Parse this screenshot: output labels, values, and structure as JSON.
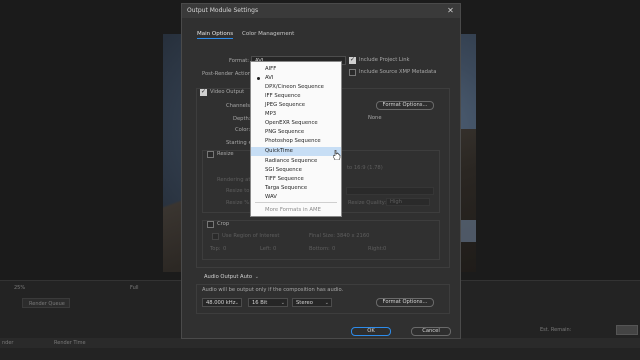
{
  "dialog": {
    "title": "Output Module Settings",
    "tabs": [
      "Main Options",
      "Color Management"
    ],
    "format_label": "Format:",
    "format_value": "AVI",
    "post_render_label": "Post-Render Action:",
    "include_project_link": "Include Project Link",
    "include_xmp": "Include Source XMP Metadata",
    "video_output": "Video Output",
    "channels_label": "Channels:",
    "depth_label": "Depth:",
    "color_label": "Color:",
    "starting_label": "Starting #:",
    "format_options": "Format Options...",
    "none_text": "None",
    "resize": "Resize",
    "rendering_at": "Rendering at:",
    "resize_to": "Resize to:",
    "resize_pct": "Resize %:",
    "resize_ratio": "to 16:9 (1.78)",
    "resize_quality_label": "Resize Quality:",
    "resize_quality_value": "High",
    "crop": "Crop",
    "use_roi": "Use Region of Interest",
    "final_size": "Final Size: 3840 x 2160",
    "top_label": "Top:",
    "left_label": "Left:",
    "bottom_label": "Bottom:",
    "right_label": "Right:",
    "zero": "0",
    "audio_output": "Audio Output Auto",
    "audio_note": "Audio will be output only if the composition has audio.",
    "sample_rate": "48.000 kHz",
    "bit_depth": "16 Bit",
    "channels_audio": "Stereo",
    "audio_format_options": "Format Options...",
    "ok": "OK",
    "cancel": "Cancel"
  },
  "dropdown": {
    "items": [
      {
        "label": "AIFF"
      },
      {
        "label": "AVI"
      },
      {
        "label": "DPX/Cineon Sequence"
      },
      {
        "label": "IFF Sequence"
      },
      {
        "label": "JPEG Sequence"
      },
      {
        "label": "MP3"
      },
      {
        "label": "OpenEXR Sequence"
      },
      {
        "label": "PNG Sequence"
      },
      {
        "label": "Photoshop Sequence"
      },
      {
        "label": "QuickTime"
      },
      {
        "label": "Radiance Sequence"
      },
      {
        "label": "SGI Sequence"
      },
      {
        "label": "TIFF Sequence"
      },
      {
        "label": "Targa Sequence"
      },
      {
        "label": "WAV"
      }
    ],
    "more": "More Formats in AME"
  },
  "background": {
    "zoom": "25%",
    "full": "Full",
    "render_queue": "Render Queue",
    "render_time": "Render Time",
    "est_remain": "Est. Remain:",
    "rendered": "nder"
  }
}
